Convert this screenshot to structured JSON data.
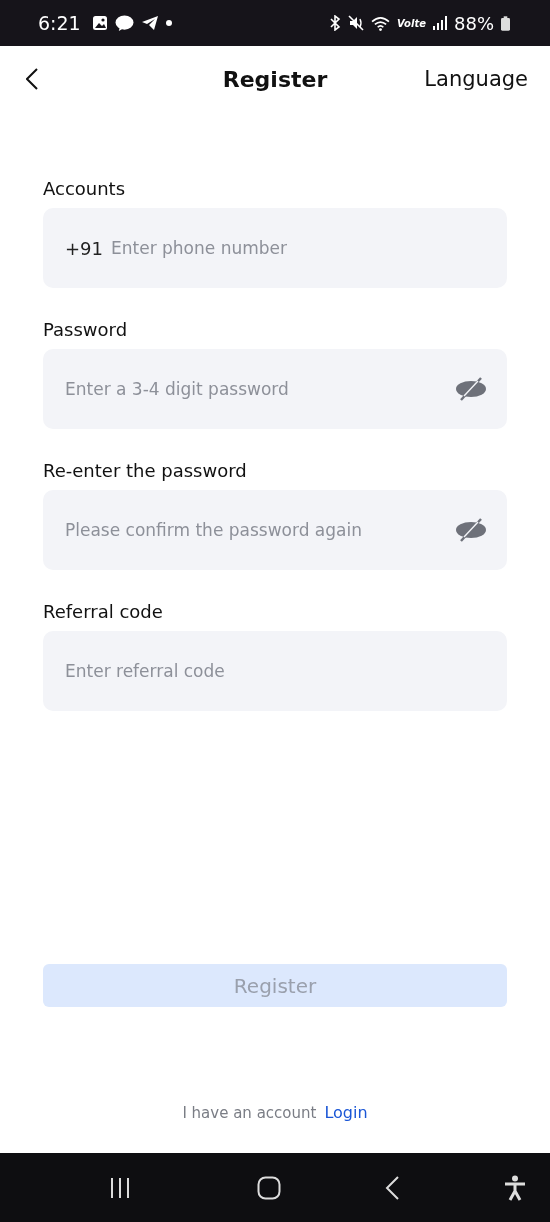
{
  "status_bar": {
    "time": "6:21",
    "network_label": "Volte",
    "battery": "88%"
  },
  "header": {
    "title": "Register",
    "language": "Language"
  },
  "fields": [
    {
      "kind": "phone",
      "label": "Accounts",
      "prefix": "+91",
      "placeholder": "Enter phone number"
    },
    {
      "kind": "password",
      "label": "Password",
      "placeholder": "Enter a 3-4 digit password",
      "visible": false
    },
    {
      "kind": "password",
      "label": "Re-enter the password",
      "placeholder": "Please confirm the password again",
      "visible": false
    },
    {
      "kind": "text",
      "label": "Referral code",
      "placeholder": "Enter referral code"
    }
  ],
  "submit": {
    "label": "Register",
    "disabled": true
  },
  "footer": {
    "text": "I have an account",
    "link": "Login"
  }
}
